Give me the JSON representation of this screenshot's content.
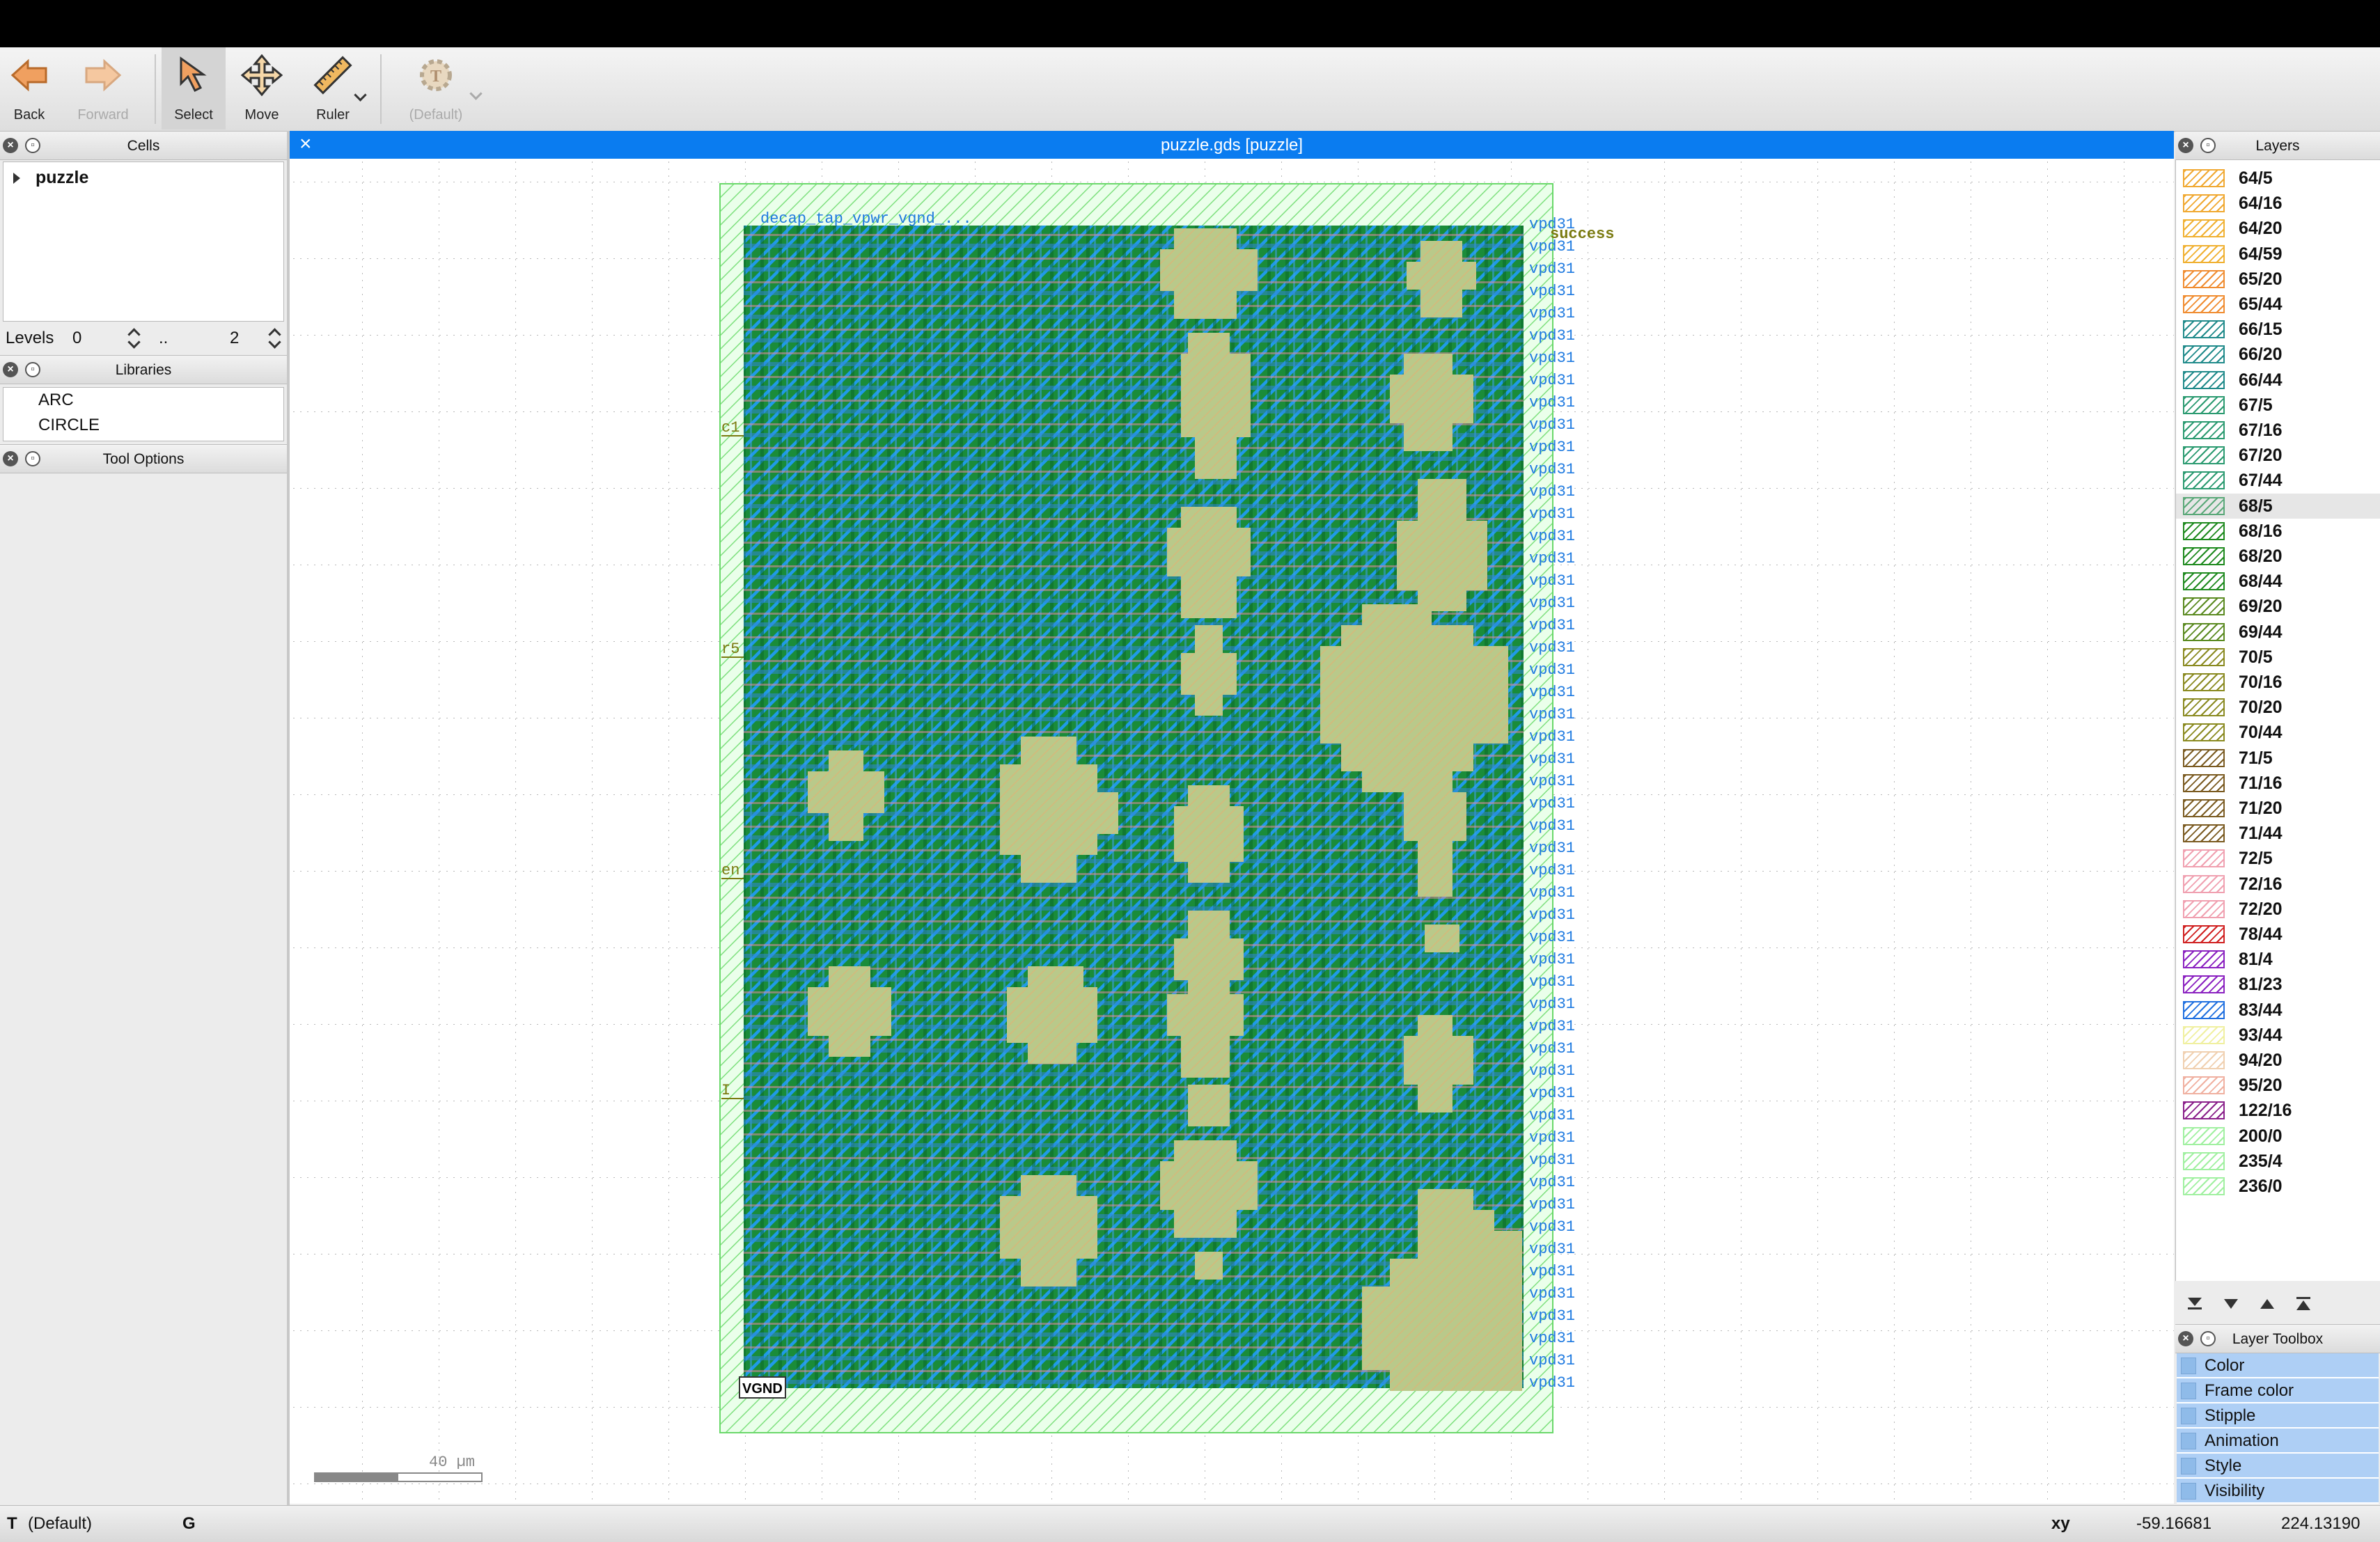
{
  "toolbar": {
    "back": "Back",
    "forward": "Forward",
    "select": "Select",
    "move": "Move",
    "ruler": "Ruler",
    "text_default": "(Default)"
  },
  "panels": {
    "cells": {
      "title": "Cells",
      "root_cell": "puzzle"
    },
    "levels": {
      "label": "Levels",
      "from": "0",
      "sep": "..",
      "to": "2"
    },
    "libraries": {
      "title": "Libraries",
      "items": [
        "ARC",
        "CIRCLE"
      ]
    },
    "tool_options": {
      "title": "Tool Options"
    }
  },
  "view": {
    "title": "puzzle.gds [puzzle]",
    "scale_label": "40 µm",
    "labels": {
      "top_text": "decap_tap_vpwr_vgnd_...",
      "success": "success",
      "vgnd": "VGND",
      "pin_c1": "c1",
      "pin_r5": "r5",
      "pin_en": "en",
      "pin_i": "I",
      "right_label": "vpd31"
    }
  },
  "layers_panel": {
    "title": "Layers",
    "selected": "68/5",
    "items": [
      {
        "name": "64/5",
        "color": "#f0a830"
      },
      {
        "name": "64/16",
        "color": "#f0a830"
      },
      {
        "name": "64/20",
        "color": "#f0b030"
      },
      {
        "name": "64/59",
        "color": "#f0b030"
      },
      {
        "name": "65/20",
        "color": "#f08c30"
      },
      {
        "name": "65/44",
        "color": "#f08c30"
      },
      {
        "name": "66/15",
        "color": "#1f8a8a"
      },
      {
        "name": "66/20",
        "color": "#1f8a8a"
      },
      {
        "name": "66/44",
        "color": "#1f8a8a"
      },
      {
        "name": "67/5",
        "color": "#2a9a70"
      },
      {
        "name": "67/16",
        "color": "#2a9a70"
      },
      {
        "name": "67/20",
        "color": "#2a9a70"
      },
      {
        "name": "67/44",
        "color": "#2a9a70"
      },
      {
        "name": "68/5",
        "color": "#59a878"
      },
      {
        "name": "68/16",
        "color": "#1e8a1e"
      },
      {
        "name": "68/20",
        "color": "#1e8a1e"
      },
      {
        "name": "68/44",
        "color": "#1e8a1e"
      },
      {
        "name": "69/20",
        "color": "#5a8a20"
      },
      {
        "name": "69/44",
        "color": "#5a8a20"
      },
      {
        "name": "70/5",
        "color": "#8a8a20"
      },
      {
        "name": "70/16",
        "color": "#8a8a20"
      },
      {
        "name": "70/20",
        "color": "#8a8a20"
      },
      {
        "name": "70/44",
        "color": "#8a8a20"
      },
      {
        "name": "71/5",
        "color": "#7a5a20"
      },
      {
        "name": "71/16",
        "color": "#7a5a20"
      },
      {
        "name": "71/20",
        "color": "#7a5a20"
      },
      {
        "name": "71/44",
        "color": "#7a5a20"
      },
      {
        "name": "72/5",
        "color": "#f0a0b0"
      },
      {
        "name": "72/16",
        "color": "#f0a0b0"
      },
      {
        "name": "72/20",
        "color": "#f0a0b0"
      },
      {
        "name": "78/44",
        "color": "#d02020"
      },
      {
        "name": "81/4",
        "color": "#8a20c0"
      },
      {
        "name": "81/23",
        "color": "#8a20c0"
      },
      {
        "name": "83/44",
        "color": "#2070e0"
      },
      {
        "name": "93/44",
        "color": "#f0f0a0"
      },
      {
        "name": "94/20",
        "color": "#f0d0b0"
      },
      {
        "name": "95/20",
        "color": "#f0b0a0"
      },
      {
        "name": "122/16",
        "color": "#8a208a"
      },
      {
        "name": "200/0",
        "color": "#a0f0a0"
      },
      {
        "name": "235/4",
        "color": "#a0f0a0"
      },
      {
        "name": "236/0",
        "color": "#a0f0a0"
      }
    ]
  },
  "layer_toolbox": {
    "title": "Layer Toolbox",
    "items": [
      "Color",
      "Frame color",
      "Stipple",
      "Animation",
      "Style",
      "Visibility"
    ]
  },
  "status": {
    "text_mode": "T",
    "text_default": "(Default)",
    "grid_key": "G",
    "coord_label": "xy",
    "x": "-59.16681",
    "y": "224.13190"
  }
}
